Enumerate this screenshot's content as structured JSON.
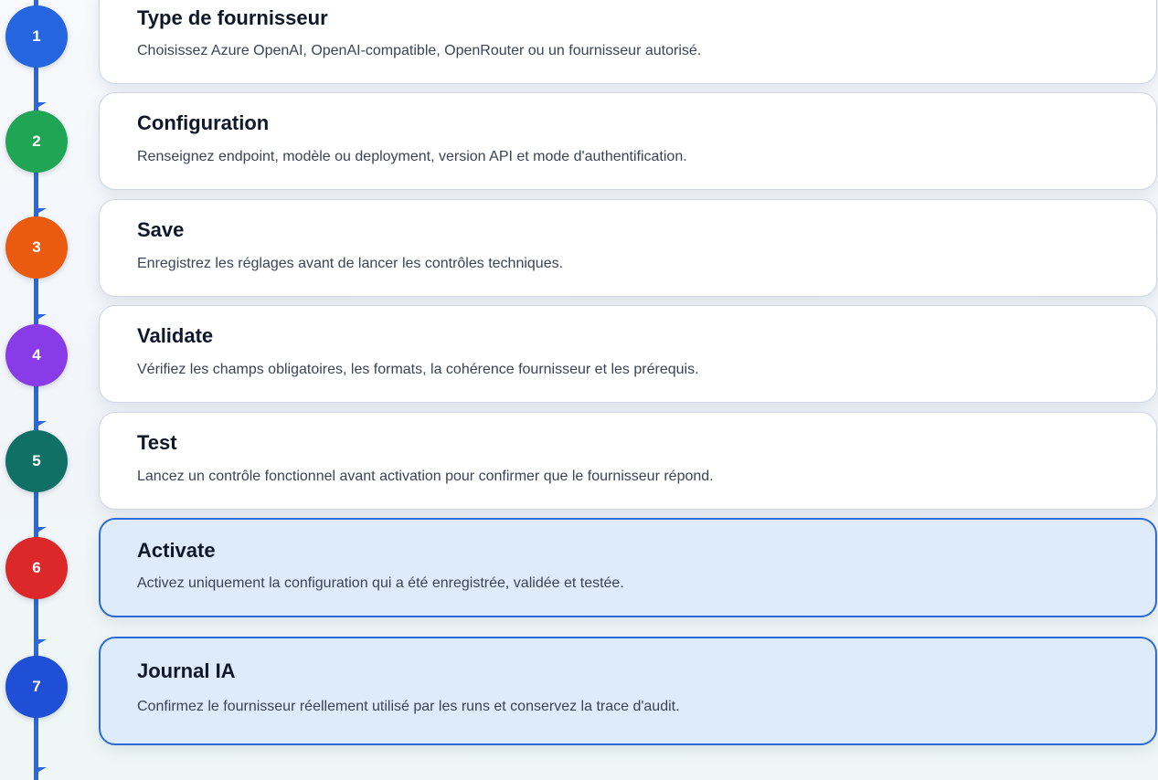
{
  "colors": {
    "rail": "#2c67dd",
    "step_1": "#2566e0",
    "step_2": "#1fa553",
    "step_3": "#ea5b10",
    "step_4": "#8a3be8",
    "step_5": "#117066",
    "step_6": "#dc2828",
    "step_7": "#1e4fd6",
    "highlight_border": "#2a6ad9",
    "highlight_fill": "#deebfb"
  },
  "steps": [
    {
      "number": "1",
      "title": "Type de fournisseur",
      "description": "Choisissez Azure OpenAI, OpenAI-compatible, OpenRouter ou un fournisseur autorisé.",
      "highlighted": false
    },
    {
      "number": "2",
      "title": "Configuration",
      "description": "Renseignez endpoint, modèle ou deployment, version API et mode d'authentification.",
      "highlighted": false
    },
    {
      "number": "3",
      "title": "Save",
      "description": "Enregistrez les réglages avant de lancer les contrôles techniques.",
      "highlighted": false
    },
    {
      "number": "4",
      "title": "Validate",
      "description": "Vérifiez les champs obligatoires, les formats, la cohérence fournisseur et les prérequis.",
      "highlighted": false
    },
    {
      "number": "5",
      "title": "Test",
      "description": "Lancez un contrôle fonctionnel avant activation pour confirmer que le fournisseur répond.",
      "highlighted": false
    },
    {
      "number": "6",
      "title": "Activate",
      "description": "Activez uniquement la configuration qui a été enregistrée, validée et testée.",
      "highlighted": true
    },
    {
      "number": "7",
      "title": "Journal IA",
      "description": "Confirmez le fournisseur réellement utilisé par les runs et conservez la trace d'audit.",
      "highlighted": true
    }
  ]
}
